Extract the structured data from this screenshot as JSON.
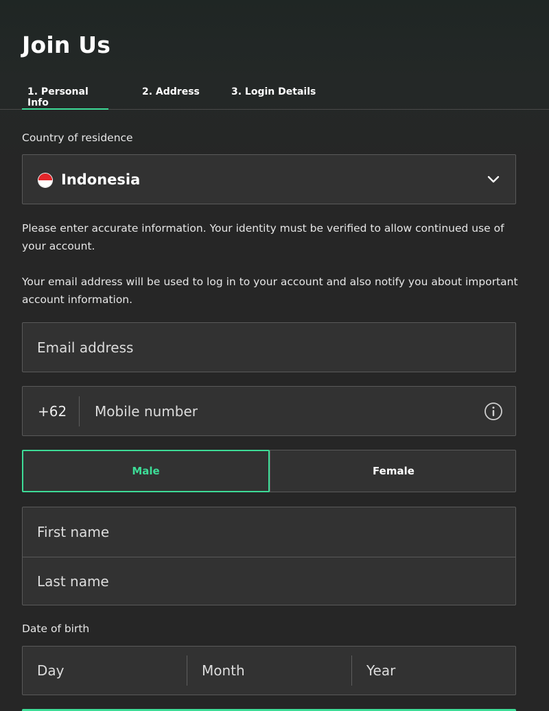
{
  "header": {
    "title": "Join Us"
  },
  "tabs": [
    {
      "label": "1. Personal Info",
      "active": true
    },
    {
      "label": "2. Address",
      "active": false
    },
    {
      "label": "3. Login Details",
      "active": false
    }
  ],
  "country": {
    "label": "Country of residence",
    "value": "Indonesia",
    "flag_icon": "indonesia-flag-icon",
    "dropdown_icon": "chevron-down-icon"
  },
  "info": {
    "identity_text": "Please enter accurate information. Your identity must be verified to allow continued use of your account.",
    "email_text": "Your email address will be used to log in to your account and also notify you about important account information."
  },
  "email": {
    "placeholder": "Email address"
  },
  "phone": {
    "prefix": "+62",
    "placeholder": "Mobile number",
    "info_icon": "info-icon"
  },
  "gender": {
    "male_label": "Male",
    "female_label": "Female",
    "selected": "Male"
  },
  "name": {
    "first_placeholder": "First name",
    "last_placeholder": "Last name"
  },
  "dob": {
    "label": "Date of birth",
    "day_placeholder": "Day",
    "month_placeholder": "Month",
    "year_placeholder": "Year"
  },
  "colors": {
    "accent": "#3ddc97",
    "background": "#262626",
    "field": "#323232",
    "border": "#5a5a5a"
  }
}
